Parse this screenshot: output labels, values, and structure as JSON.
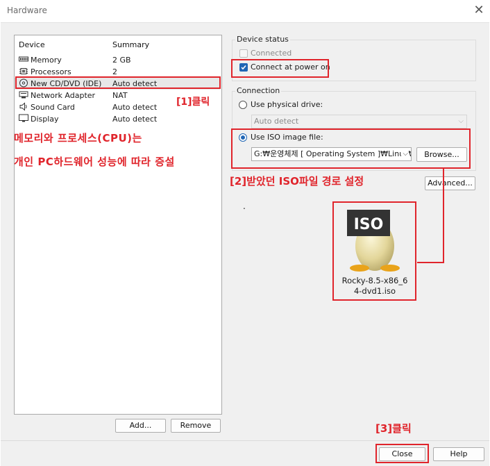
{
  "window": {
    "title": "Hardware",
    "close_glyph": "✕"
  },
  "device_list": {
    "col_device": "Device",
    "col_summary": "Summary",
    "items": [
      {
        "name": "Memory",
        "summary": "2 GB",
        "icon": "memory-icon"
      },
      {
        "name": "Processors",
        "summary": "2",
        "icon": "processor-icon"
      },
      {
        "name": "New CD/DVD (IDE)",
        "summary": "Auto detect",
        "icon": "cd-dvd-icon",
        "selected": true
      },
      {
        "name": "Network Adapter",
        "summary": "NAT",
        "icon": "network-adapter-icon"
      },
      {
        "name": "Sound Card",
        "summary": "Auto detect",
        "icon": "sound-card-icon"
      },
      {
        "name": "Display",
        "summary": "Auto detect",
        "icon": "display-icon"
      }
    ],
    "add_label": "Add...",
    "remove_label": "Remove"
  },
  "device_status": {
    "title": "Device status",
    "connected_label": "Connected",
    "connected_checked": false,
    "connect_power_label": "Connect at power on",
    "connect_power_checked": true
  },
  "connection": {
    "title": "Connection",
    "physical_label": "Use physical drive:",
    "physical_value": "Auto detect",
    "iso_label": "Use ISO image file:",
    "iso_path": "G:₩운영체제 [ Operating System ]₩Linux₩",
    "browse_label": "Browse...",
    "selected": "iso"
  },
  "advanced_label": "Advanced...",
  "dot": ".",
  "iso_file": {
    "badge": "ISO",
    "filename_line1": "Rocky-8.5-x86_6",
    "filename_line2": "4-dvd1.iso"
  },
  "annotations": {
    "step1": "[1]클릭",
    "memory_note_line1": "메모리와 프로세스(CPU)는",
    "memory_note_line2": "개인 PC하드웨어 성능에 따라 증설",
    "step2": "[2]받았던 ISO파일 경로 설정",
    "step3": "[3]클릭",
    "color": "#e0242b"
  },
  "footer": {
    "close_label": "Close",
    "help_label": "Help"
  }
}
